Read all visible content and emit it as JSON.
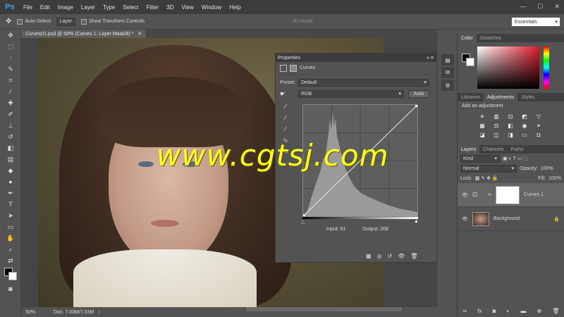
{
  "app": {
    "logo": "Ps"
  },
  "menu": [
    "File",
    "Edit",
    "Image",
    "Layer",
    "Type",
    "Select",
    "Filter",
    "3D",
    "View",
    "Window",
    "Help"
  ],
  "options": {
    "auto_select": "Auto-Select:",
    "layer": "Layer",
    "transform": "Show Transform Controls",
    "mode3d": "3D Mode:",
    "workspace": "Essentials"
  },
  "document": {
    "tab": "Curves01.psd @ 50% (Curves 1, Layer Mask/8) *",
    "zoom": "50%",
    "doc_info": "Doc: 7.03M/7.03M"
  },
  "watermark": "www.cgtsj.com",
  "properties": {
    "title": "Properties",
    "type": "Curves",
    "preset_label": "Preset:",
    "preset_value": "Default",
    "channel": "RGB",
    "auto": "Auto",
    "input_label": "Input:",
    "input_value": "51",
    "output_label": "Output:",
    "output_value": "208"
  },
  "color_panel": {
    "tabs": [
      "Color",
      "Swatches"
    ]
  },
  "adj_panel": {
    "tabs": [
      "Libraries",
      "Adjustments",
      "Styles"
    ],
    "hint": "Add an adjustment"
  },
  "layers_panel": {
    "tabs": [
      "Layers",
      "Channels",
      "Paths"
    ],
    "kind": "Kind",
    "blend": "Normal",
    "opacity_label": "Opacity:",
    "opacity": "100%",
    "lock_label": "Lock:",
    "fill_label": "Fill:",
    "fill": "100%",
    "layers": [
      {
        "name": "Curves 1"
      },
      {
        "name": "Background"
      }
    ]
  }
}
